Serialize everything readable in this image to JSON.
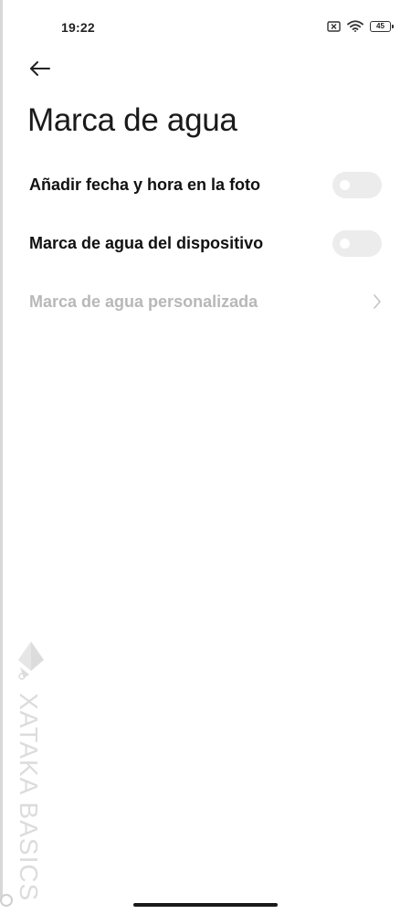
{
  "status_bar": {
    "time": "19:22",
    "battery_level": "45",
    "icons": [
      "sim-x-icon",
      "wifi-icon",
      "battery-icon"
    ]
  },
  "header": {
    "back_icon": "arrow-left-icon",
    "title": "Marca de agua"
  },
  "settings": [
    {
      "label": "Añadir fecha y hora en la foto",
      "type": "toggle",
      "checked": false,
      "enabled": true
    },
    {
      "label": "Marca de agua del dispositivo",
      "type": "toggle",
      "checked": false,
      "enabled": true
    },
    {
      "label": "Marca de agua personalizada",
      "type": "link",
      "enabled": false,
      "icon": "chevron-right-icon"
    }
  ],
  "watermark": {
    "text": "XATAKA BASICS",
    "logo_icon": "xataka-logo-icon"
  },
  "colors": {
    "background": "#ffffff",
    "text_primary": "#111111",
    "text_disabled": "#b8b8b8",
    "toggle_off_track": "#ececec",
    "watermark": "#dcdcdc"
  }
}
